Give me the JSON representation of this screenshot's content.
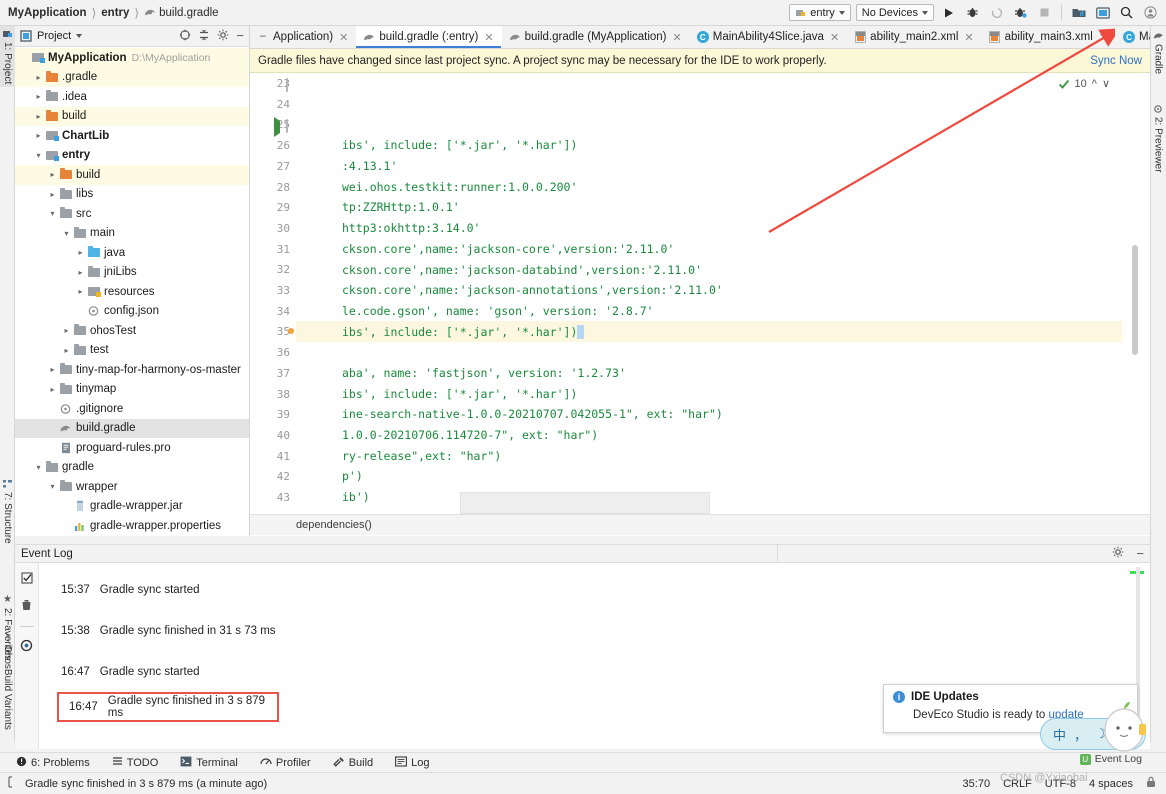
{
  "breadcrumb": {
    "items": [
      "MyApplication",
      "entry",
      "build.gradle"
    ]
  },
  "toolbar": {
    "run_config": "entry",
    "device": "No Devices",
    "icons": [
      "run-icon",
      "debug-icon",
      "run-coverage-icon",
      "profile-icon",
      "stop-icon",
      "sdk-manager-icon",
      "device-manager-icon",
      "search-everywhere-icon",
      "account-icon"
    ]
  },
  "left_strip": {
    "tabs": [
      {
        "label": "1: Project",
        "selected": true
      },
      {
        "label": "7: Structure",
        "selected": false
      },
      {
        "label": "2: Favorites",
        "selected": false
      },
      {
        "label": "OhosBuild Variants",
        "selected": false
      }
    ]
  },
  "right_strip": {
    "tabs": [
      {
        "label": "Gradle"
      },
      {
        "label": "2: Previewer"
      }
    ]
  },
  "project_panel": {
    "title": "Project",
    "tree": [
      {
        "indent": 0,
        "arrow": "",
        "icon": "module-icon",
        "label": "MyApplication",
        "bold": true,
        "path": "D:\\MyApplication",
        "hl": "hl-y"
      },
      {
        "indent": 1,
        "arrow": ">",
        "icon": "folder-orange-icon",
        "label": ".gradle",
        "bold": false,
        "path": "",
        "hl": "hl-y"
      },
      {
        "indent": 1,
        "arrow": ">",
        "icon": "folder-grey-icon",
        "label": ".idea",
        "bold": false,
        "path": "",
        "hl": ""
      },
      {
        "indent": 1,
        "arrow": ">",
        "icon": "folder-orange-icon",
        "label": "build",
        "bold": false,
        "path": "",
        "hl": "hl-y"
      },
      {
        "indent": 1,
        "arrow": ">",
        "icon": "module-icon",
        "label": "ChartLib",
        "bold": true,
        "path": "",
        "hl": ""
      },
      {
        "indent": 1,
        "arrow": "v",
        "icon": "module-icon",
        "label": "entry",
        "bold": true,
        "path": "",
        "hl": ""
      },
      {
        "indent": 2,
        "arrow": ">",
        "icon": "folder-orange-icon",
        "label": "build",
        "bold": false,
        "path": "",
        "hl": "hl-y"
      },
      {
        "indent": 2,
        "arrow": ">",
        "icon": "folder-grey-icon",
        "label": "libs",
        "bold": false,
        "path": "",
        "hl": ""
      },
      {
        "indent": 2,
        "arrow": "v",
        "icon": "folder-grey-icon",
        "label": "src",
        "bold": false,
        "path": "",
        "hl": ""
      },
      {
        "indent": 3,
        "arrow": "v",
        "icon": "folder-grey-icon",
        "label": "main",
        "bold": false,
        "path": "",
        "hl": ""
      },
      {
        "indent": 4,
        "arrow": ">",
        "icon": "folder-blue-icon",
        "label": "java",
        "bold": false,
        "path": "",
        "hl": ""
      },
      {
        "indent": 4,
        "arrow": ">",
        "icon": "folder-grey-icon",
        "label": "jniLibs",
        "bold": false,
        "path": "",
        "hl": ""
      },
      {
        "indent": 4,
        "arrow": ">",
        "icon": "resource-folder-icon",
        "label": "resources",
        "bold": false,
        "path": "",
        "hl": ""
      },
      {
        "indent": 4,
        "arrow": "",
        "icon": "json-file-icon",
        "label": "config.json",
        "bold": false,
        "path": "",
        "hl": ""
      },
      {
        "indent": 3,
        "arrow": ">",
        "icon": "folder-grey-icon",
        "label": "ohosTest",
        "bold": false,
        "path": "",
        "hl": ""
      },
      {
        "indent": 3,
        "arrow": ">",
        "icon": "folder-grey-icon",
        "label": "test",
        "bold": false,
        "path": "",
        "hl": ""
      },
      {
        "indent": 2,
        "arrow": ">",
        "icon": "folder-grey-icon",
        "label": "tiny-map-for-harmony-os-master",
        "bold": false,
        "path": "",
        "hl": ""
      },
      {
        "indent": 2,
        "arrow": ">",
        "icon": "folder-grey-icon",
        "label": "tinymap",
        "bold": false,
        "path": "",
        "hl": ""
      },
      {
        "indent": 2,
        "arrow": "",
        "icon": "git-file-icon",
        "label": ".gitignore",
        "bold": false,
        "path": "",
        "hl": ""
      },
      {
        "indent": 2,
        "arrow": "",
        "icon": "gradle-file-icon",
        "label": "build.gradle",
        "bold": false,
        "path": "",
        "hl": "hl-g"
      },
      {
        "indent": 2,
        "arrow": "",
        "icon": "text-file-icon",
        "label": "proguard-rules.pro",
        "bold": false,
        "path": "",
        "hl": ""
      },
      {
        "indent": 1,
        "arrow": "v",
        "icon": "folder-grey-icon",
        "label": "gradle",
        "bold": false,
        "path": "",
        "hl": ""
      },
      {
        "indent": 2,
        "arrow": "v",
        "icon": "folder-grey-icon",
        "label": "wrapper",
        "bold": false,
        "path": "",
        "hl": ""
      },
      {
        "indent": 3,
        "arrow": "",
        "icon": "jar-file-icon",
        "label": "gradle-wrapper.jar",
        "bold": false,
        "path": "",
        "hl": ""
      },
      {
        "indent": 3,
        "arrow": "",
        "icon": "properties-file-icon",
        "label": "gradle-wrapper.properties",
        "bold": false,
        "path": "",
        "hl": ""
      }
    ]
  },
  "editor": {
    "tabs": [
      {
        "label": "Application)",
        "icon": "dash-icon",
        "active": false
      },
      {
        "label": "build.gradle (:entry)",
        "icon": "gradle-file-icon",
        "active": true
      },
      {
        "label": "build.gradle (MyApplication)",
        "icon": "gradle-file-icon",
        "active": false
      },
      {
        "label": "MainAbility4Slice.java",
        "icon": "class-icon",
        "active": false
      },
      {
        "label": "ability_main2.xml",
        "icon": "xml-layout-icon",
        "active": false
      },
      {
        "label": "ability_main3.xml",
        "icon": "xml-layout-icon",
        "active": false
      },
      {
        "label": "MainAbilitySlice.java",
        "icon": "class-icon",
        "active": false
      }
    ],
    "sync_banner": {
      "message": "Gradle files have changed since last project sync. A project sync may be necessary for the IDE to work properly.",
      "action": "Sync Now"
    },
    "inspection": {
      "count": "10"
    },
    "breadcrumb_bottom": "dependencies()",
    "lines": [
      {
        "num": "23",
        "text": "",
        "marker": "fold",
        "hl": false
      },
      {
        "num": "24",
        "text": "",
        "marker": "",
        "hl": false
      },
      {
        "num": "25",
        "text": "",
        "marker": "run",
        "hl": false
      },
      {
        "num": "26",
        "text": "ibs', include: ['*.jar', '*.har'])",
        "marker": "",
        "hl": false
      },
      {
        "num": "27",
        "text": ":4.13.1'",
        "marker": "",
        "hl": false
      },
      {
        "num": "28",
        "text": "wei.ohos.testkit:runner:1.0.0.200'",
        "marker": "",
        "hl": false
      },
      {
        "num": "29",
        "text": "tp:ZZRHttp:1.0.1'",
        "marker": "",
        "hl": false
      },
      {
        "num": "30",
        "text": "http3:okhttp:3.14.0'",
        "marker": "",
        "hl": false
      },
      {
        "num": "31",
        "text": "ckson.core',name:'jackson-core',version:'2.11.0'",
        "marker": "",
        "hl": false
      },
      {
        "num": "32",
        "text": "ckson.core',name:'jackson-databind',version:'2.11.0'",
        "marker": "",
        "hl": false
      },
      {
        "num": "33",
        "text": "ckson.core',name:'jackson-annotations',version:'2.11.0'",
        "marker": "",
        "hl": false
      },
      {
        "num": "34",
        "text": "le.code.gson', name: 'gson', version: '2.8.7'",
        "marker": "",
        "hl": false
      },
      {
        "num": "35",
        "text": "ibs', include: ['*.jar', '*.har'])",
        "marker": "dot",
        "hl": true
      },
      {
        "num": "36",
        "text": "",
        "marker": "",
        "hl": false
      },
      {
        "num": "37",
        "text": "aba', name: 'fastjson', version: '1.2.73'",
        "marker": "",
        "hl": false
      },
      {
        "num": "38",
        "text": "ibs', include: ['*.jar', '*.har'])",
        "marker": "",
        "hl": false
      },
      {
        "num": "39",
        "text": "ine-search-native-1.0.0-20210707.042055-1\", ext: \"har\")",
        "marker": "",
        "hl": false
      },
      {
        "num": "40",
        "text": "1.0.0-20210706.114720-7\", ext: \"har\")",
        "marker": "",
        "hl": false
      },
      {
        "num": "41",
        "text": "ry-release\",ext: \"har\")",
        "marker": "",
        "hl": false
      },
      {
        "num": "42",
        "text": "p')",
        "marker": "",
        "hl": false
      },
      {
        "num": "43",
        "text": "ib')",
        "marker": "",
        "hl": false
      },
      {
        "num": "44",
        "text": "",
        "marker": "",
        "hl": false
      }
    ]
  },
  "event_log": {
    "title": "Event Log",
    "entries": [
      {
        "time": "15:37",
        "message": "Gradle sync started",
        "boxed": false
      },
      {
        "time": "15:38",
        "message": "Gradle sync finished in 31 s 73 ms",
        "boxed": false
      },
      {
        "time": "16:47",
        "message": "Gradle sync started",
        "boxed": false
      },
      {
        "time": "16:47",
        "message": "Gradle sync finished in 3 s 879 ms",
        "boxed": true
      }
    ]
  },
  "bottom_bar": {
    "items": [
      {
        "label": "6: Problems",
        "icon": "problems-icon"
      },
      {
        "label": "TODO",
        "icon": "todo-icon"
      },
      {
        "label": "Terminal",
        "icon": "terminal-icon"
      },
      {
        "label": "Profiler",
        "icon": "profiler-icon"
      },
      {
        "label": "Build",
        "icon": "build-hammer-icon"
      },
      {
        "label": "Log",
        "icon": "log-icon"
      }
    ],
    "event_log_tag": "Event Log"
  },
  "status_bar": {
    "message": "Gradle sync finished in 3 s 879 ms (a minute ago)",
    "caret": "35:70",
    "line_sep": "CRLF",
    "encoding": "UTF-8",
    "indent": "4 spaces",
    "watermark": "CSDN @Yxiaobai"
  },
  "notification": {
    "title": "IDE Updates",
    "body_prefix": "DevEco Studio is ready to ",
    "body_link": "update"
  },
  "ime": {
    "glyphs": [
      "中",
      "，",
      "☽",
      "👕"
    ]
  },
  "colors": {
    "accent_blue": "#2f6fc0",
    "banner_yellow": "#fbf8d8",
    "code_green": "#1a8a3c",
    "annotation_red": "#e8564a",
    "highlight_row": "#fdfbe3"
  }
}
